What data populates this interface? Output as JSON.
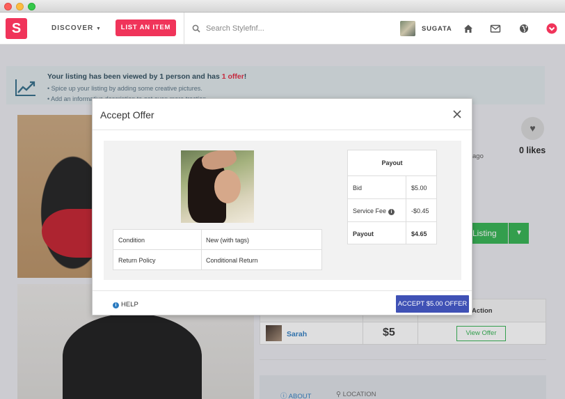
{
  "nav": {
    "logo_letter": "S",
    "discover_label": "DISCOVER",
    "list_item_label": "LIST AN ITEM",
    "search_placeholder": "Search Stylefnf...",
    "username": "SUGATA"
  },
  "notice": {
    "title_part1": "Your listing has been viewed by 1 person and has ",
    "title_offer": "1 offer",
    "title_end": "!",
    "tip1": "Spice up your listing by adding some creative pictures.",
    "tip2": "Add an informative description to get even more traction."
  },
  "listing": {
    "likes": "0 likes",
    "posted_ago": "ago",
    "listing_button": "Listing",
    "offers_table": {
      "action_header": "Action",
      "rows": [
        {
          "name": "Sarah",
          "amount": "$5",
          "action": "View Offer"
        }
      ]
    },
    "tabs": {
      "about": "ABOUT",
      "location": "LOCATION"
    }
  },
  "modal": {
    "title": "Accept Offer",
    "condition_rows": [
      {
        "key": "Condition",
        "value": "New (with tags)"
      },
      {
        "key": "Return Policy",
        "value": "Conditional Return"
      }
    ],
    "payout": {
      "header": "Payout",
      "rows": [
        {
          "key": "Bid",
          "value": "$5.00"
        },
        {
          "key": "Service Fee",
          "value": "-$0.45"
        },
        {
          "key": "Payout",
          "value": "$4.65"
        }
      ]
    },
    "help_label": "HELP",
    "accept_button": "ACCEPT $5.00 OFFER"
  },
  "colors": {
    "brand": "#f0345a",
    "accept": "#3f51b5",
    "green": "#2fb14d",
    "link": "#2b7bc0"
  }
}
